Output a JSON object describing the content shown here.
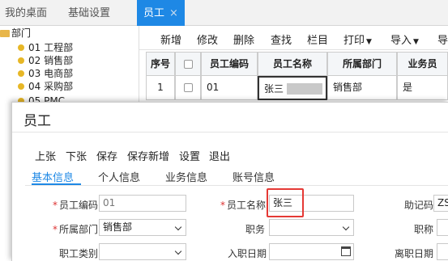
{
  "tabs": [
    {
      "label": "我的桌面"
    },
    {
      "label": "基础设置"
    },
    {
      "label": "员工",
      "close": "×"
    }
  ],
  "tree": {
    "root": "部门",
    "items": [
      "01 工程部",
      "02 销售部",
      "03 电商部",
      "04 采购部",
      "05 PMC"
    ]
  },
  "toolbar": {
    "items": [
      "新增",
      "修改",
      "删除",
      "查找",
      "栏目",
      "打印",
      "导入",
      "导"
    ]
  },
  "table": {
    "headers": [
      "序号",
      "",
      "员工编码",
      "员工名称",
      "所属部门",
      "业务员"
    ],
    "row": [
      "1",
      "",
      "01",
      "张三",
      "销售部",
      "是"
    ]
  },
  "modal": {
    "title": "员工",
    "actions": [
      "上张",
      "下张",
      "保存",
      "保存新增",
      "设置",
      "退出"
    ],
    "tabs": [
      "基本信息",
      "个人信息",
      "业务信息",
      "账号信息"
    ],
    "fields": {
      "emp_code_label": "员工编码",
      "emp_code_value": "01",
      "emp_name_label": "员工名称",
      "emp_name_value": "张三",
      "mnemonic_label": "助记码",
      "mnemonic_value": "ZS",
      "dept_label": "所属部门",
      "dept_value": "销售部",
      "position_label": "职务",
      "position_value": "",
      "title_label": "职称",
      "category_label": "职工类别",
      "hire_date_label": "入职日期",
      "leave_date_label": "离职日期"
    }
  },
  "colors": {
    "accent": "#1e88e5",
    "highlight": "#e53935",
    "folder": "#e8b64a",
    "dot": "#e7b726"
  }
}
